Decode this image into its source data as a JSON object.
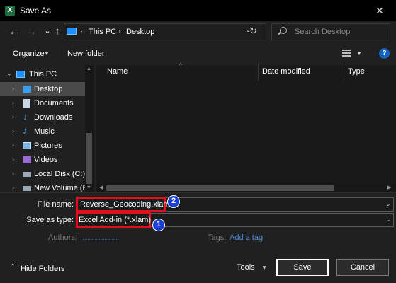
{
  "window": {
    "title": "Save As",
    "app_icon": "excel-icon",
    "close_glyph": "✕"
  },
  "nav": {
    "back_glyph": "←",
    "forward_glyph": "→",
    "recent_glyph": "⌄",
    "up_glyph": "↑",
    "breadcrumb": [
      "This PC",
      "Desktop"
    ],
    "crumb_sep": "›",
    "refresh_glyph": "↻",
    "search_placeholder": "Search Desktop"
  },
  "toolbar": {
    "organize_label": "Organize",
    "new_folder_label": "New folder",
    "help_glyph": "?"
  },
  "tree": {
    "items": [
      {
        "label": "This PC",
        "icon": "pc-icon",
        "color": "#3a9ff0"
      },
      {
        "label": "Desktop",
        "icon": "desktop-icon",
        "color": "#3a9ff0",
        "selected": true
      },
      {
        "label": "Documents",
        "icon": "documents-icon",
        "color": "#c9d6e6"
      },
      {
        "label": "Downloads",
        "icon": "downloads-icon",
        "color": "#3a9ff0"
      },
      {
        "label": "Music",
        "icon": "music-icon",
        "color": "#3a9ff0"
      },
      {
        "label": "Pictures",
        "icon": "pictures-icon",
        "color": "#7ab6e8"
      },
      {
        "label": "Videos",
        "icon": "videos-icon",
        "color": "#9b6ad8"
      },
      {
        "label": "Local Disk (C:)",
        "icon": "disk-icon",
        "color": "#9aa7b5"
      },
      {
        "label": "New Volume (E:)",
        "icon": "disk-icon",
        "color": "#9aa7b5"
      }
    ]
  },
  "columns": {
    "name": "Name",
    "date_modified": "Date modified",
    "type": "Type"
  },
  "form": {
    "file_name_label": "File name:",
    "file_name_value": "Reverse_Geocoding.xlam",
    "save_as_type_label": "Save as type:",
    "save_as_type_value": "Excel Add-in (*.xlam)",
    "authors_label": "Authors:",
    "authors_value": "",
    "tags_label": "Tags:",
    "tags_value": "Add a tag",
    "badge_1": "1",
    "badge_2": "2"
  },
  "footer": {
    "hide_folders_label": "Hide Folders",
    "tools_label": "Tools",
    "save_label": "Save",
    "cancel_label": "Cancel"
  },
  "colors": {
    "highlight": "#e01020",
    "badge": "#1a3fd6"
  }
}
